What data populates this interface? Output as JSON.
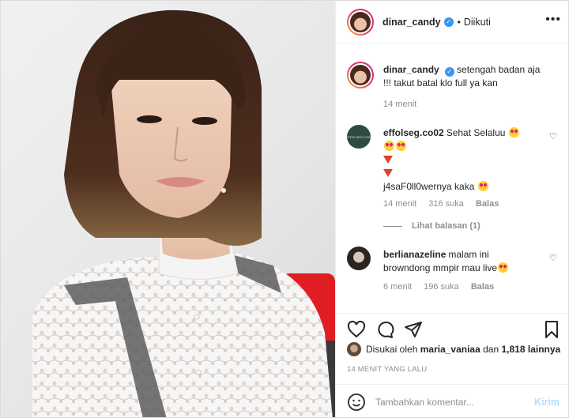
{
  "header": {
    "username": "dinar_candy",
    "verified_icon": "verified-badge-icon",
    "dot": "•",
    "follow_state": "Diikuti",
    "more_icon": "•••"
  },
  "caption": {
    "username": "dinar_candy",
    "text": "setengah badan aja !!! takut batal klo full ya kan",
    "time": "14 menit"
  },
  "comments": [
    {
      "username": "effolseg.co02",
      "avatar_text": "EFFOLSEG.CO02",
      "line1": "Sehat Selaluu",
      "line4": "j4saF0ll0wernya kaka",
      "time": "14 menit",
      "likes": "316 suka",
      "reply": "Balas",
      "view_replies": "Lihat balasan (1)"
    },
    {
      "username": "berlianazeline",
      "line1": "malam ini",
      "line2": "browndong mmpir mau live",
      "time": "6 menit",
      "likes": "196 suka",
      "reply": "Balas"
    }
  ],
  "actions": {
    "liked_by_prefix": "Disukai oleh",
    "liked_by_user": "maria_vaniaa",
    "liked_by_middle": "dan",
    "liked_by_count": "1,818 lainnya",
    "timestamp": "14 MENIT YANG LALU"
  },
  "composer": {
    "placeholder": "Tambahkan komentar...",
    "post_label": "Kirim"
  },
  "colors": {
    "verified": "#3897f0",
    "meta": "#8e8e8e",
    "post_disabled": "#b2dffc"
  }
}
